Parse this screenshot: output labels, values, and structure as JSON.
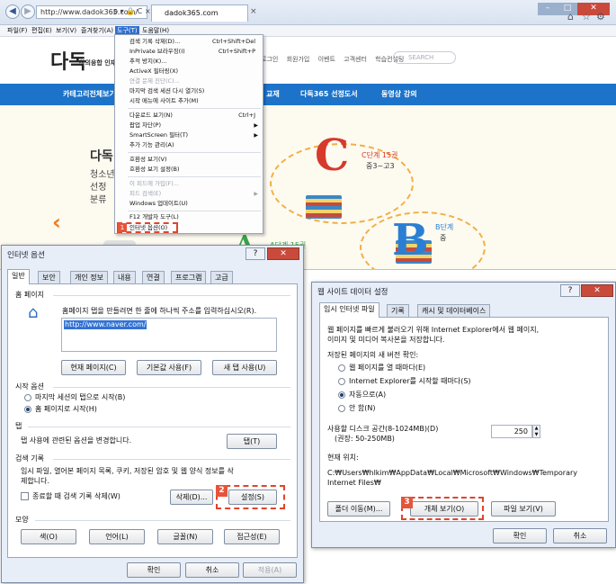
{
  "browser": {
    "url": "http://www.dadok365.com/",
    "url_controls": "ρ ▾ 🔒 C ×",
    "tab_title": "dadok365.com",
    "menu": [
      "파일(F)",
      "편집(E)",
      "보기(V)",
      "즐겨찾기(A)",
      "도구(T)",
      "도움말(H)"
    ]
  },
  "site": {
    "logo": "다독",
    "logo_sub": "창의융합 인재",
    "top_links": [
      "로그인",
      "회원가입",
      "이벤트",
      "고객센터",
      "학습컨설팅"
    ],
    "search_placeholder": "SEARCH",
    "nav": [
      "카테고리전체보기",
      "교재",
      "다독365 선정도서",
      "동영상 강의"
    ],
    "hero_title": "다독",
    "hero_lines": [
      "청소년",
      "선정",
      "분류"
    ],
    "grades": [
      {
        "letter": "C",
        "label": "C단계 15권",
        "sub": "중3~고3",
        "color": "#d63a2b"
      },
      {
        "letter": "B",
        "label": "B단계",
        "sub": "중",
        "color": "#2a7fd4"
      },
      {
        "letter": "A",
        "label": "A단계 15권",
        "sub": "",
        "color": "#3aa34a"
      }
    ]
  },
  "tools_menu": {
    "items": [
      {
        "label": "검색 기록 삭제(D)...",
        "shortcut": "Ctrl+Shift+Del",
        "disabled": false
      },
      {
        "label": "InPrivate 브라우징(I)",
        "shortcut": "Ctrl+Shift+P",
        "disabled": false
      },
      {
        "label": "추적 방지(K)...",
        "shortcut": "",
        "disabled": false
      },
      {
        "label": "ActiveX 필터링(X)",
        "shortcut": "",
        "disabled": false
      },
      {
        "label": "연결 문제 진단(C)...",
        "shortcut": "",
        "disabled": true
      },
      {
        "label": "마지막 검색 세션 다시 열기(S)",
        "shortcut": "",
        "disabled": false
      },
      {
        "label": "시작 메뉴에 사이트 추가(M)",
        "shortcut": "",
        "disabled": false
      },
      {
        "label": "다운로드 보기(N)",
        "shortcut": "Ctrl+J",
        "disabled": false
      },
      {
        "label": "팝업 차단(P)",
        "shortcut": "",
        "disabled": false,
        "submenu": true
      },
      {
        "label": "SmartScreen 필터(T)",
        "shortcut": "",
        "disabled": false,
        "submenu": true
      },
      {
        "label": "추가 기능 관리(A)",
        "shortcut": "",
        "disabled": false
      },
      {
        "label": "호환성 보기(V)",
        "shortcut": "",
        "disabled": false
      },
      {
        "label": "호환성 보기 설정(B)",
        "shortcut": "",
        "disabled": false
      },
      {
        "label": "이 피드에 가입(F)...",
        "shortcut": "",
        "disabled": true
      },
      {
        "label": "피드 검색(E)",
        "shortcut": "",
        "disabled": true,
        "submenu": true
      },
      {
        "label": "Windows 업데이트(U)",
        "shortcut": "",
        "disabled": false
      },
      {
        "label": "F12 개발자 도구(L)",
        "shortcut": "",
        "disabled": false
      },
      {
        "label": "인터넷 옵션(O)",
        "shortcut": "",
        "disabled": false
      }
    ],
    "badge": "1"
  },
  "internet_options": {
    "title": "인터넷 옵션",
    "tabs": [
      "일반",
      "보안",
      "개인 정보",
      "내용",
      "연결",
      "프로그램",
      "고급"
    ],
    "home_section": "홈 페이지",
    "home_desc": "홈페이지 탭을 만들려면 한 줄에 하나씩 주소를 입력하십시오(R).",
    "home_url": "http://www.naver.com/",
    "home_buttons": [
      "현재 페이지(C)",
      "기본값 사용(F)",
      "새 탭 사용(U)"
    ],
    "startup_section": "시작 옵션",
    "startup_options": [
      "마지막 세션의 탭으로 시작(B)",
      "홈 페이지로 시작(H)"
    ],
    "tabs_section": "탭",
    "tabs_desc": "탭 사용에 관련된 옵션을 변경합니다.",
    "tabs_button": "탭(T)",
    "history_section": "검색 기록",
    "history_desc": [
      "임시 파일, 열어본 페이지 목록, 쿠키, 저장된 암호 및 웹 양식 정보를 삭",
      "제합니다."
    ],
    "history_check": "종료할 때 검색 기록 삭제(W)",
    "delete_button": "삭제(D)...",
    "settings_button": "설정(S)",
    "settings_badge": "2",
    "appearance_section": "모양",
    "appearance_buttons": [
      "색(O)",
      "언어(L)",
      "글꼴(N)",
      "접근성(E)"
    ],
    "ok": "확인",
    "cancel": "취소",
    "apply": "적용(A)"
  },
  "website_data": {
    "title": "웹 사이트 데이터 설정",
    "tabs": [
      "임시 인터넷 파일",
      "기록",
      "캐시 및 데이터베이스"
    ],
    "desc": [
      "웹 페이지를 빠르게 불러오기 위해 Internet Explorer에서 웹 페이지,",
      "이미지 및 미디어 복사본을 저장합니다."
    ],
    "check_label": "저장된 페이지의 새 버전 확인:",
    "radios": [
      "웹 페이지를 열 때마다(E)",
      "Internet Explorer를 시작할 때마다(S)",
      "자동으로(A)",
      "안 함(N)"
    ],
    "disk_label": "사용할 디스크 공간(8-1024MB)(D)",
    "disk_hint": "(권장: 50-250MB)",
    "disk_value": "250",
    "location_label": "현재 위치:",
    "location_path": [
      "C:₩Users₩hlkim₩AppData₩Local₩Microsoft₩Windows₩Temporary",
      "Internet Files₩"
    ],
    "move_button": "폴더 이동(M)...",
    "view_objects_button": "개체 보기(O)",
    "view_files_button": "파일 보기(V)",
    "badge": "3",
    "ok": "확인",
    "cancel": "취소"
  }
}
